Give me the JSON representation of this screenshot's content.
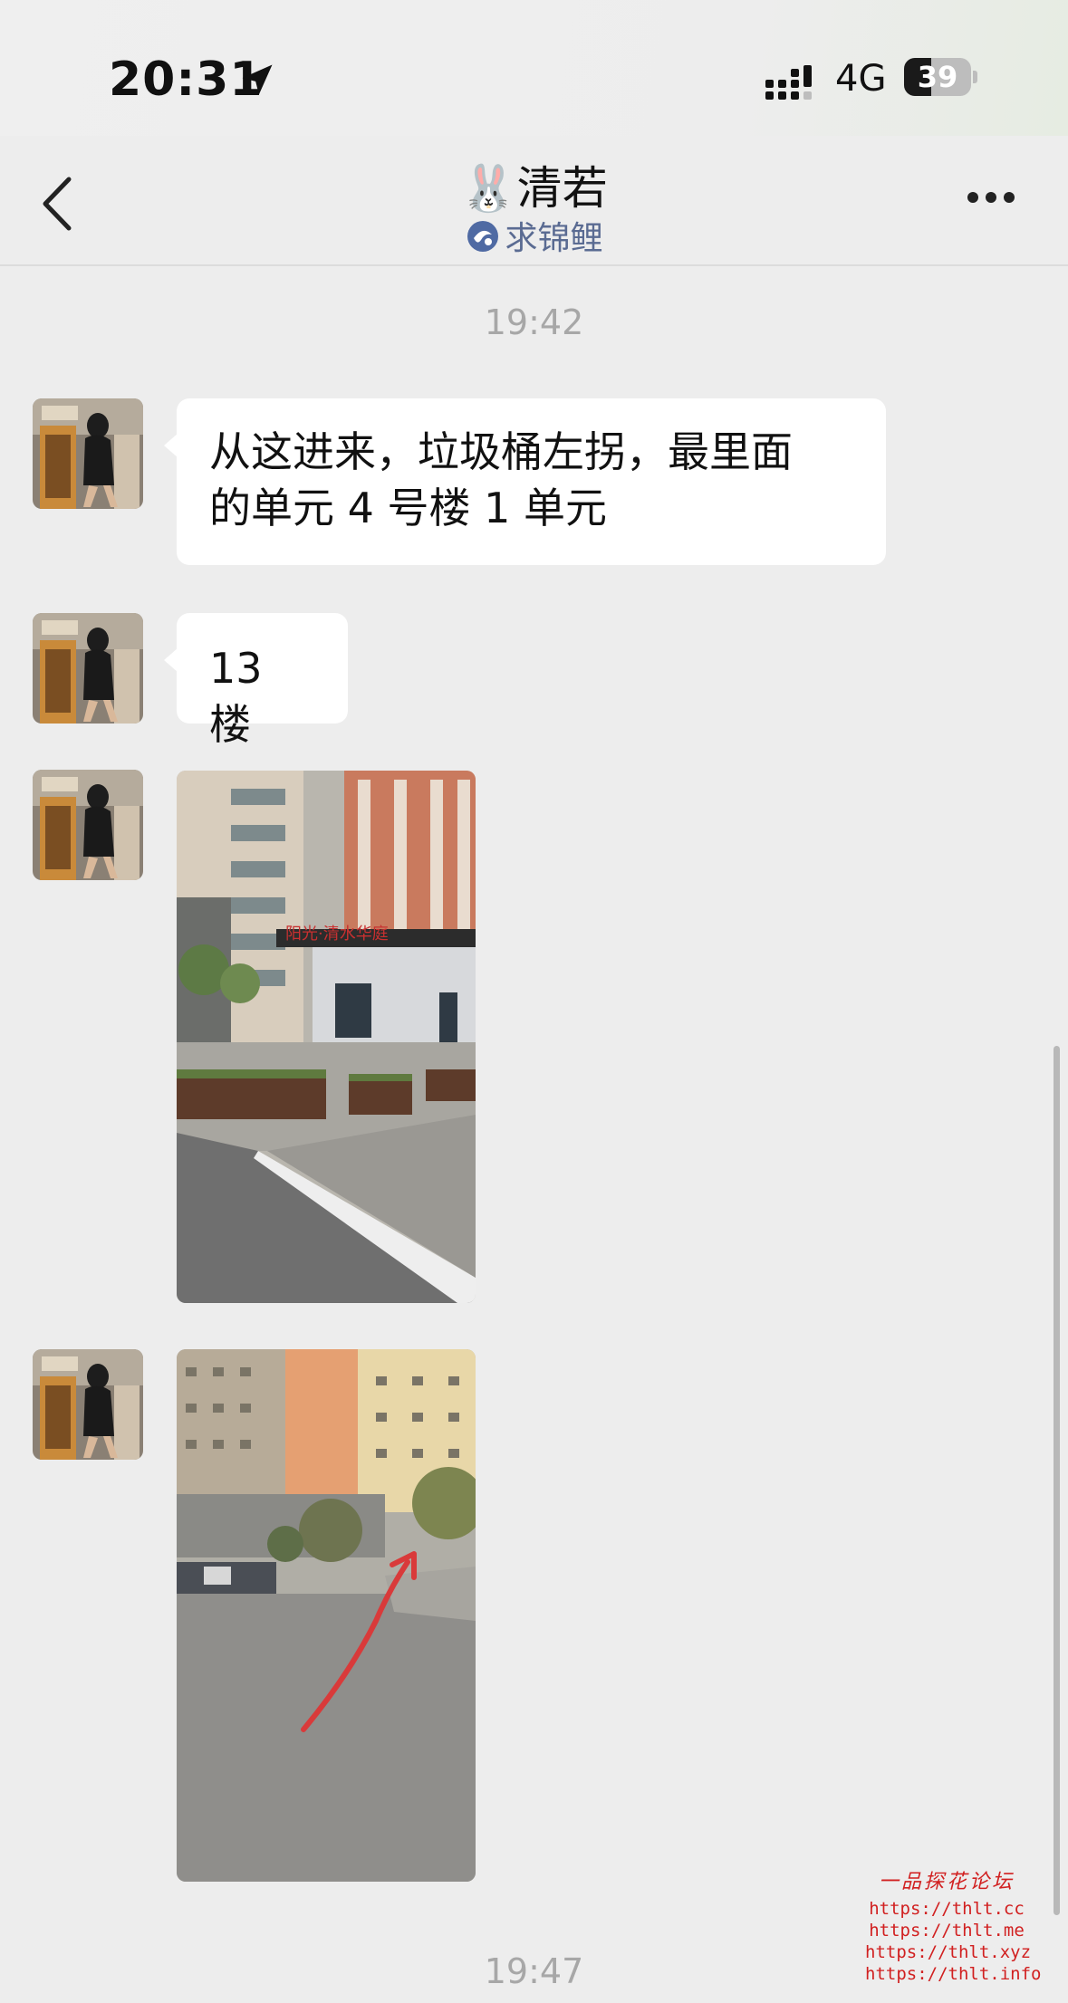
{
  "status_bar": {
    "time": "20:31",
    "network": "4G",
    "battery": "39"
  },
  "header": {
    "title": "🐰清若",
    "subtitle": "求锦鲤"
  },
  "chat": {
    "timestamps": [
      "19:42",
      "19:47"
    ],
    "messages": [
      {
        "type": "text",
        "line1": "从这进来，垃圾桶左拐，最里面",
        "line2": "的单元 4 号楼 1 单元"
      },
      {
        "type": "text",
        "line1": "13 楼"
      },
      {
        "type": "image",
        "description": "photo"
      },
      {
        "type": "image",
        "description": "photo"
      }
    ]
  },
  "watermark": {
    "title": "一品探花论坛",
    "links": [
      "https://thlt.cc",
      "https://thlt.me",
      "https://thlt.xyz",
      "https://thlt.info"
    ]
  },
  "icons": {
    "back": "chevron-left-icon",
    "more": "more-dots-icon",
    "location": "location-arrow-icon",
    "signal": "signal-icon"
  }
}
